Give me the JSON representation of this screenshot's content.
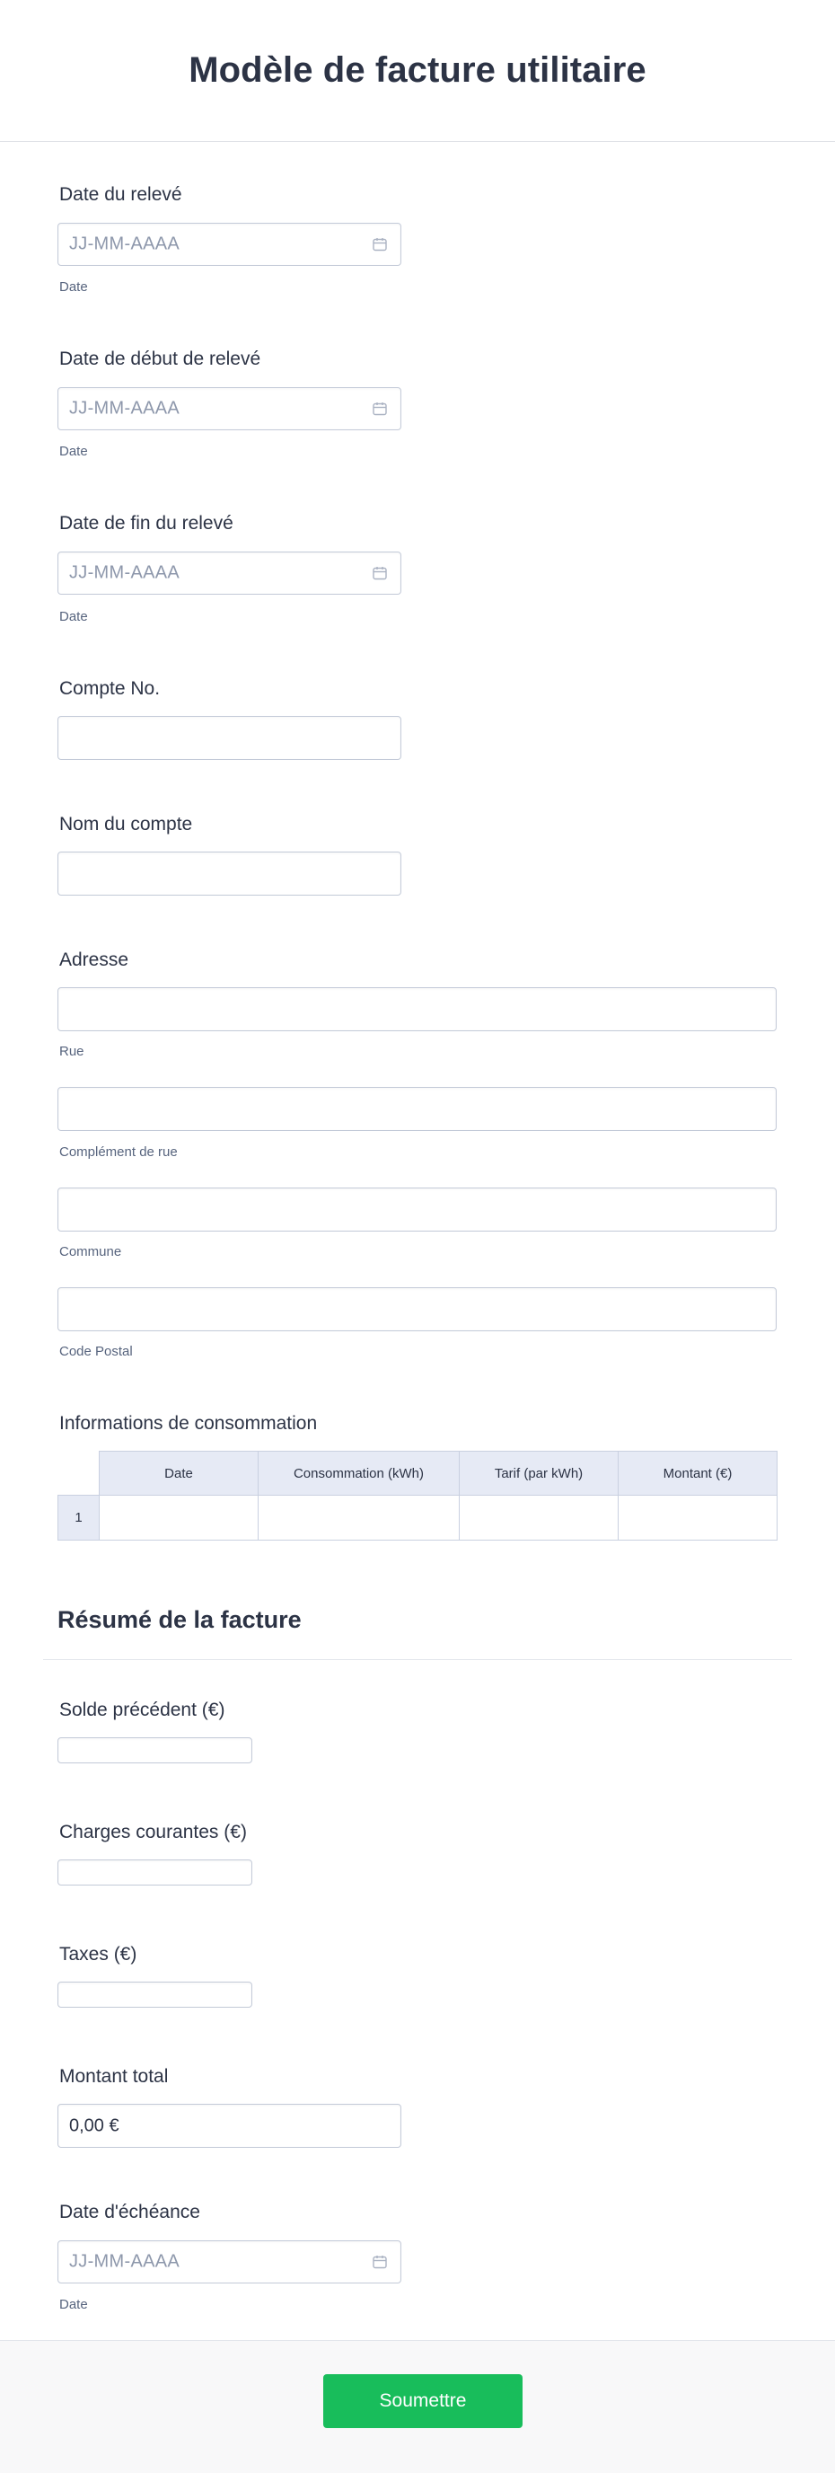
{
  "form": {
    "title": "Modèle de facture utilitaire"
  },
  "fields": {
    "statement_date": {
      "label": "Date du relevé",
      "placeholder": "JJ-MM-AAAA",
      "sublabel": "Date"
    },
    "start_date": {
      "label": "Date de début de relevé",
      "placeholder": "JJ-MM-AAAA",
      "sublabel": "Date"
    },
    "end_date": {
      "label": "Date de fin du relevé",
      "placeholder": "JJ-MM-AAAA",
      "sublabel": "Date"
    },
    "account_no": {
      "label": "Compte No."
    },
    "account_name": {
      "label": "Nom du compte"
    },
    "address": {
      "label": "Adresse",
      "street": "Rue",
      "street2": "Complément de rue",
      "city": "Commune",
      "postal": "Code Postal"
    },
    "consumption": {
      "label": "Informations de consommation",
      "columns": [
        "Date",
        "Consommation (kWh)",
        "Tarif (par kWh)",
        "Montant (€)"
      ],
      "rows": [
        "1"
      ]
    }
  },
  "summary": {
    "title": "Résumé de la facture",
    "previous_balance": {
      "label": "Solde précédent (€)"
    },
    "current_charges": {
      "label": "Charges courantes (€)"
    },
    "taxes": {
      "label": "Taxes (€)"
    },
    "total": {
      "label": "Montant total",
      "value": "0,00  €"
    },
    "due_date": {
      "label": "Date d'échéance",
      "placeholder": "JJ-MM-AAAA",
      "sublabel": "Date"
    }
  },
  "footer": {
    "submit_label": "Soumettre"
  },
  "colors": {
    "submit": "#18bd5b",
    "text": "#2c3345",
    "table_header": "#e6eaf5"
  },
  "icons": {
    "date": "calendar-icon"
  }
}
